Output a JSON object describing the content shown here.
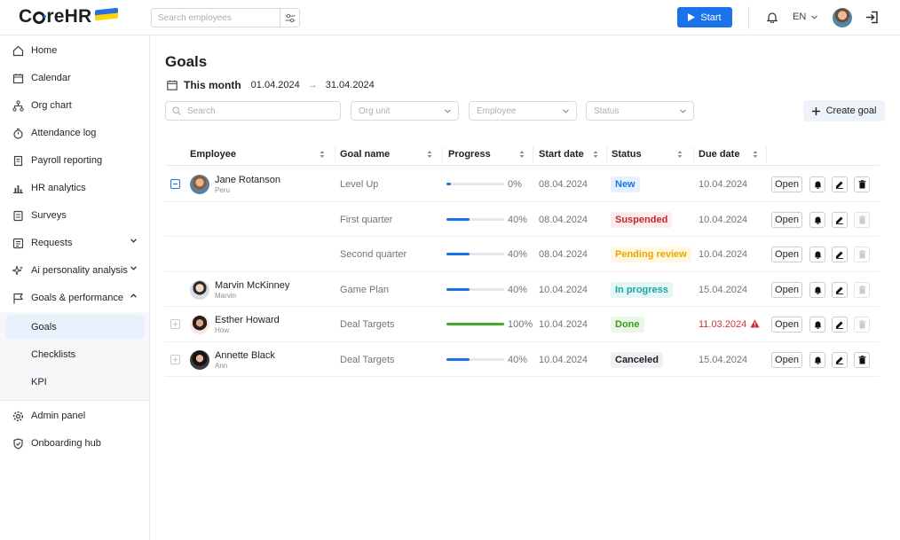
{
  "header": {
    "logo_text_left": "C",
    "logo_text_right": "reHR",
    "search_placeholder": "Search employees",
    "start_label": "Start",
    "language": "EN"
  },
  "sidebar": {
    "items": [
      {
        "label": "Home",
        "icon": "home-icon"
      },
      {
        "label": "Calendar",
        "icon": "calendar-icon"
      },
      {
        "label": "Org chart",
        "icon": "org-chart-icon"
      },
      {
        "label": "Attendance log",
        "icon": "stopwatch-icon"
      },
      {
        "label": "Payroll reporting",
        "icon": "document-icon"
      },
      {
        "label": "HR analytics",
        "icon": "bar-chart-icon"
      },
      {
        "label": "Surveys",
        "icon": "survey-icon"
      },
      {
        "label": "Requests",
        "icon": "requests-icon"
      },
      {
        "label": "Ai personality analysis",
        "icon": "sparkle-icon"
      },
      {
        "label": "Goals & performance",
        "icon": "flag-icon"
      }
    ],
    "subitems": [
      "Goals",
      "Checklists",
      "KPI"
    ],
    "bottom_items": [
      {
        "label": "Admin panel",
        "icon": "gear-icon"
      },
      {
        "label": "Onboarding hub",
        "icon": "shield-check-icon"
      }
    ]
  },
  "main": {
    "title": "Goals",
    "period_label": "This month",
    "period_start": "01.04.2024",
    "period_arrow": "→",
    "period_end": "31.04.2024",
    "search_placeholder": "Search",
    "filters": [
      "Org unit",
      "Employee",
      "Status"
    ],
    "create_label": "Create goal"
  },
  "table": {
    "columns": [
      "Employee",
      "Goal name",
      "Progress",
      "Start date",
      "Status",
      "Due date"
    ],
    "rows": [
      {
        "employee": "Jane Rotanson",
        "employee_sub": "Peru",
        "goal": "Level Up",
        "progress": 0,
        "progress_label": "0%",
        "start": "08.04.2024",
        "status": "New",
        "due": "10.04.2024"
      },
      {
        "employee": "",
        "employee_sub": "",
        "goal": "First quarter",
        "progress": 40,
        "progress_label": "40%",
        "start": "08.04.2024",
        "status": "Suspended",
        "due": "10.04.2024"
      },
      {
        "employee": "",
        "employee_sub": "",
        "goal": "Second quarter",
        "progress": 40,
        "progress_label": "40%",
        "start": "08.04.2024",
        "status": "Pending review",
        "due": "10.04.2024"
      },
      {
        "employee": "Marvin McKinney",
        "employee_sub": "Marvin",
        "goal": "Game Plan",
        "progress": 40,
        "progress_label": "40%",
        "start": "10.04.2024",
        "status": "In progress",
        "due": "15.04.2024"
      },
      {
        "employee": "Esther Howard",
        "employee_sub": "How",
        "goal": "Deal Targets",
        "progress": 100,
        "progress_label": "100%",
        "start": "10.04.2024",
        "status": "Done",
        "due": "11.03.2024"
      },
      {
        "employee": "Annette Black",
        "employee_sub": "Ann",
        "goal": "Deal Targets",
        "progress": 40,
        "progress_label": "40%",
        "start": "10.04.2024",
        "status": "Canceled",
        "due": "15.04.2024"
      }
    ],
    "open_label": "Open"
  },
  "colors": {
    "accent": "#1a73e8",
    "status_new": "#1a73e8",
    "status_suspended": "#c62828",
    "status_pending": "#e6a700",
    "status_in_progress": "#1aa6a6",
    "status_done": "#3a9d23",
    "status_canceled": "#1c1f24",
    "overdue": "#d32f2f"
  }
}
